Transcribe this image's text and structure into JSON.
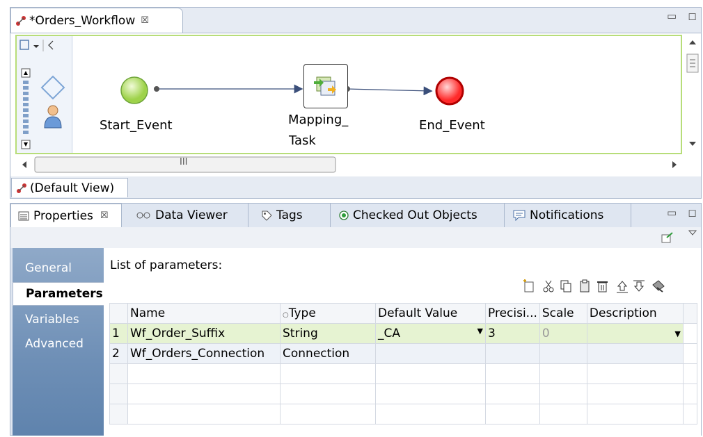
{
  "editor": {
    "tab_title": "*Orders_Workflow",
    "tab_close": "☒",
    "min": "▭",
    "max": "◻",
    "scroll_label": "III",
    "view_tab": "(Default View)"
  },
  "workflow": {
    "start_label": "Start_Event",
    "task_label_1": "Mapping_",
    "task_label_2": "Task",
    "end_label": "End_Event"
  },
  "panel": {
    "tabs": [
      {
        "label": "Properties",
        "close": "☒"
      },
      {
        "label": "Data Viewer"
      },
      {
        "label": "Tags"
      },
      {
        "label": "Checked Out Objects"
      },
      {
        "label": "Notifications"
      }
    ],
    "nav": [
      "General",
      "Parameters",
      "Variables",
      "Advanced"
    ],
    "list_title": "List of parameters:"
  },
  "table": {
    "columns": [
      "Name",
      "Type",
      "Default Value",
      "Precisi...",
      "Scale",
      "Description"
    ],
    "rows": [
      {
        "num": "1",
        "name": "Wf_Order_Suffix",
        "type": "String",
        "default": "_CA",
        "precision": "3",
        "scale": "0",
        "description": ""
      },
      {
        "num": "2",
        "name": "Wf_Orders_Connection",
        "type": "Connection",
        "default": "",
        "precision": "",
        "scale": "",
        "description": ""
      }
    ]
  },
  "colors": {
    "start": "#b5e06a",
    "end": "#ff3333",
    "accent_green": "#b7dd79",
    "nav_blue": "#6e8fb6"
  }
}
